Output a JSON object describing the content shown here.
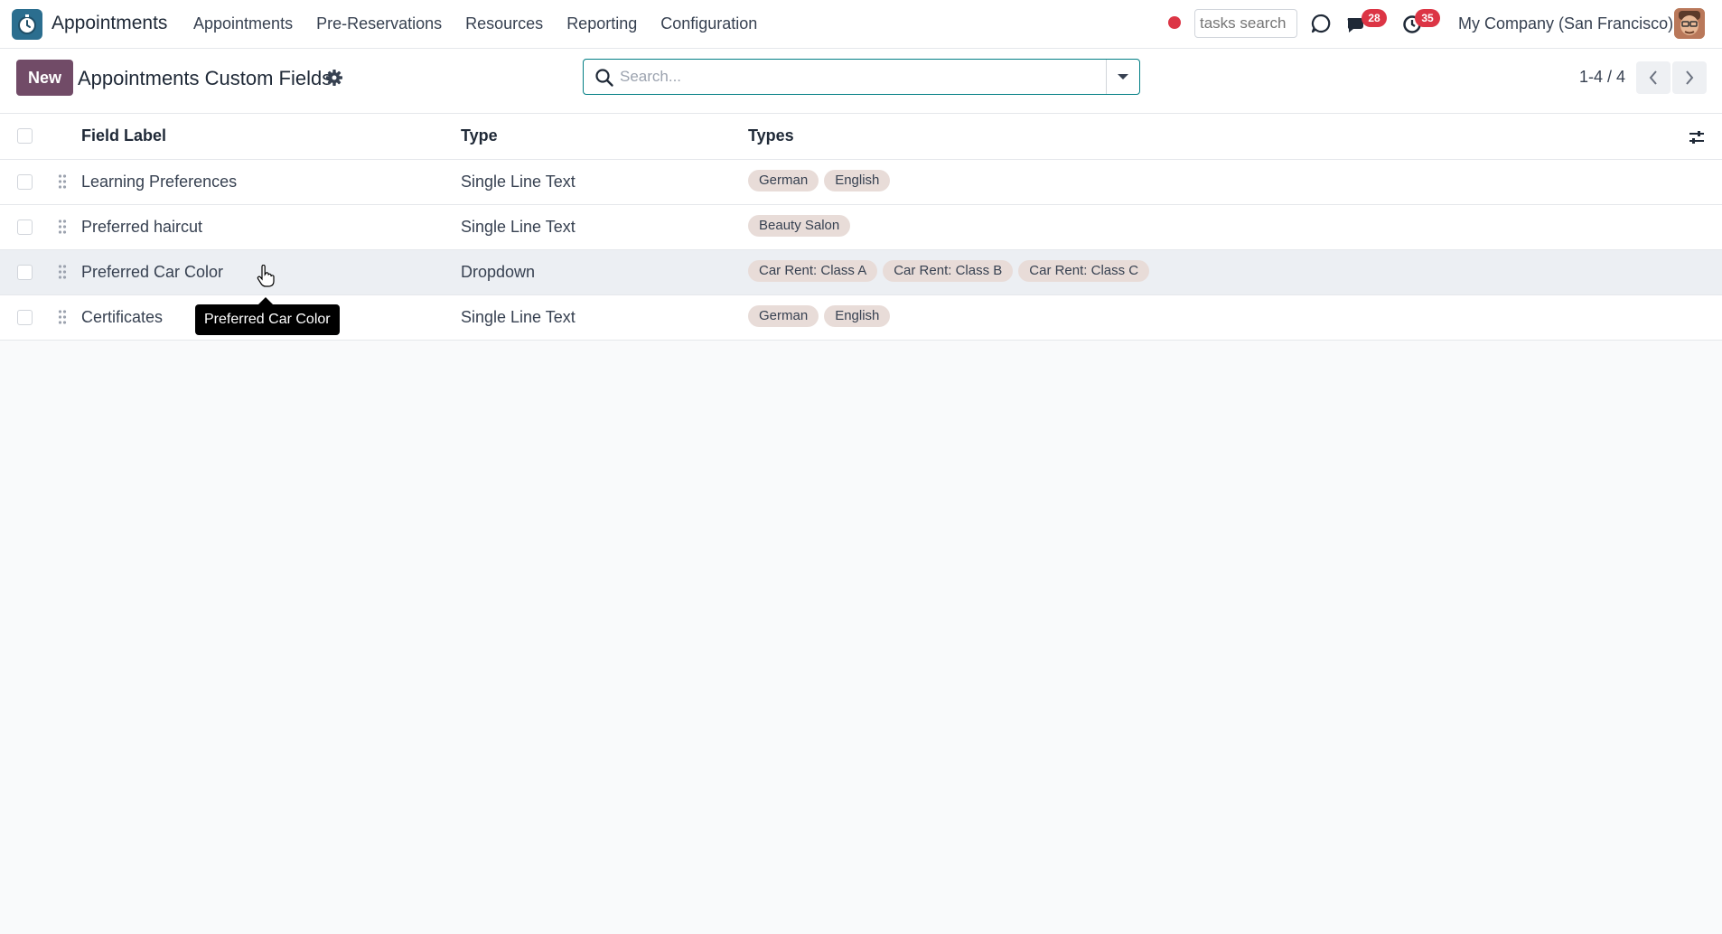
{
  "navbar": {
    "app_name": "Appointments",
    "menu": [
      "Appointments",
      "Pre-Reservations",
      "Resources",
      "Reporting",
      "Configuration"
    ],
    "tasks_search_placeholder": "tasks search",
    "messages_count": "28",
    "activities_count": "35",
    "company": "My Company (San Francisco)"
  },
  "control": {
    "new_label": "New",
    "title": "Appointments Custom Fields",
    "search_placeholder": "Search...",
    "pager": "1-4 / 4"
  },
  "table": {
    "headers": [
      "Field Label",
      "Type",
      "Types"
    ],
    "rows": [
      {
        "label": "Learning Preferences",
        "type": "Single Line Text",
        "types": [
          "German",
          "English"
        ]
      },
      {
        "label": "Preferred haircut",
        "type": "Single Line Text",
        "types": [
          "Beauty Salon"
        ]
      },
      {
        "label": "Preferred Car Color",
        "type": "Dropdown",
        "types": [
          "Car Rent: Class A",
          "Car Rent: Class B",
          "Car Rent: Class C"
        ]
      },
      {
        "label": "Certificates",
        "type": "Single Line Text",
        "types": [
          "German",
          "English"
        ]
      }
    ]
  },
  "tooltip": "Preferred Car Color",
  "colors": {
    "brand": "#714b67",
    "accent": "#017e84",
    "badge": "#dc3545",
    "tag_bg": "#e8dcd8"
  }
}
